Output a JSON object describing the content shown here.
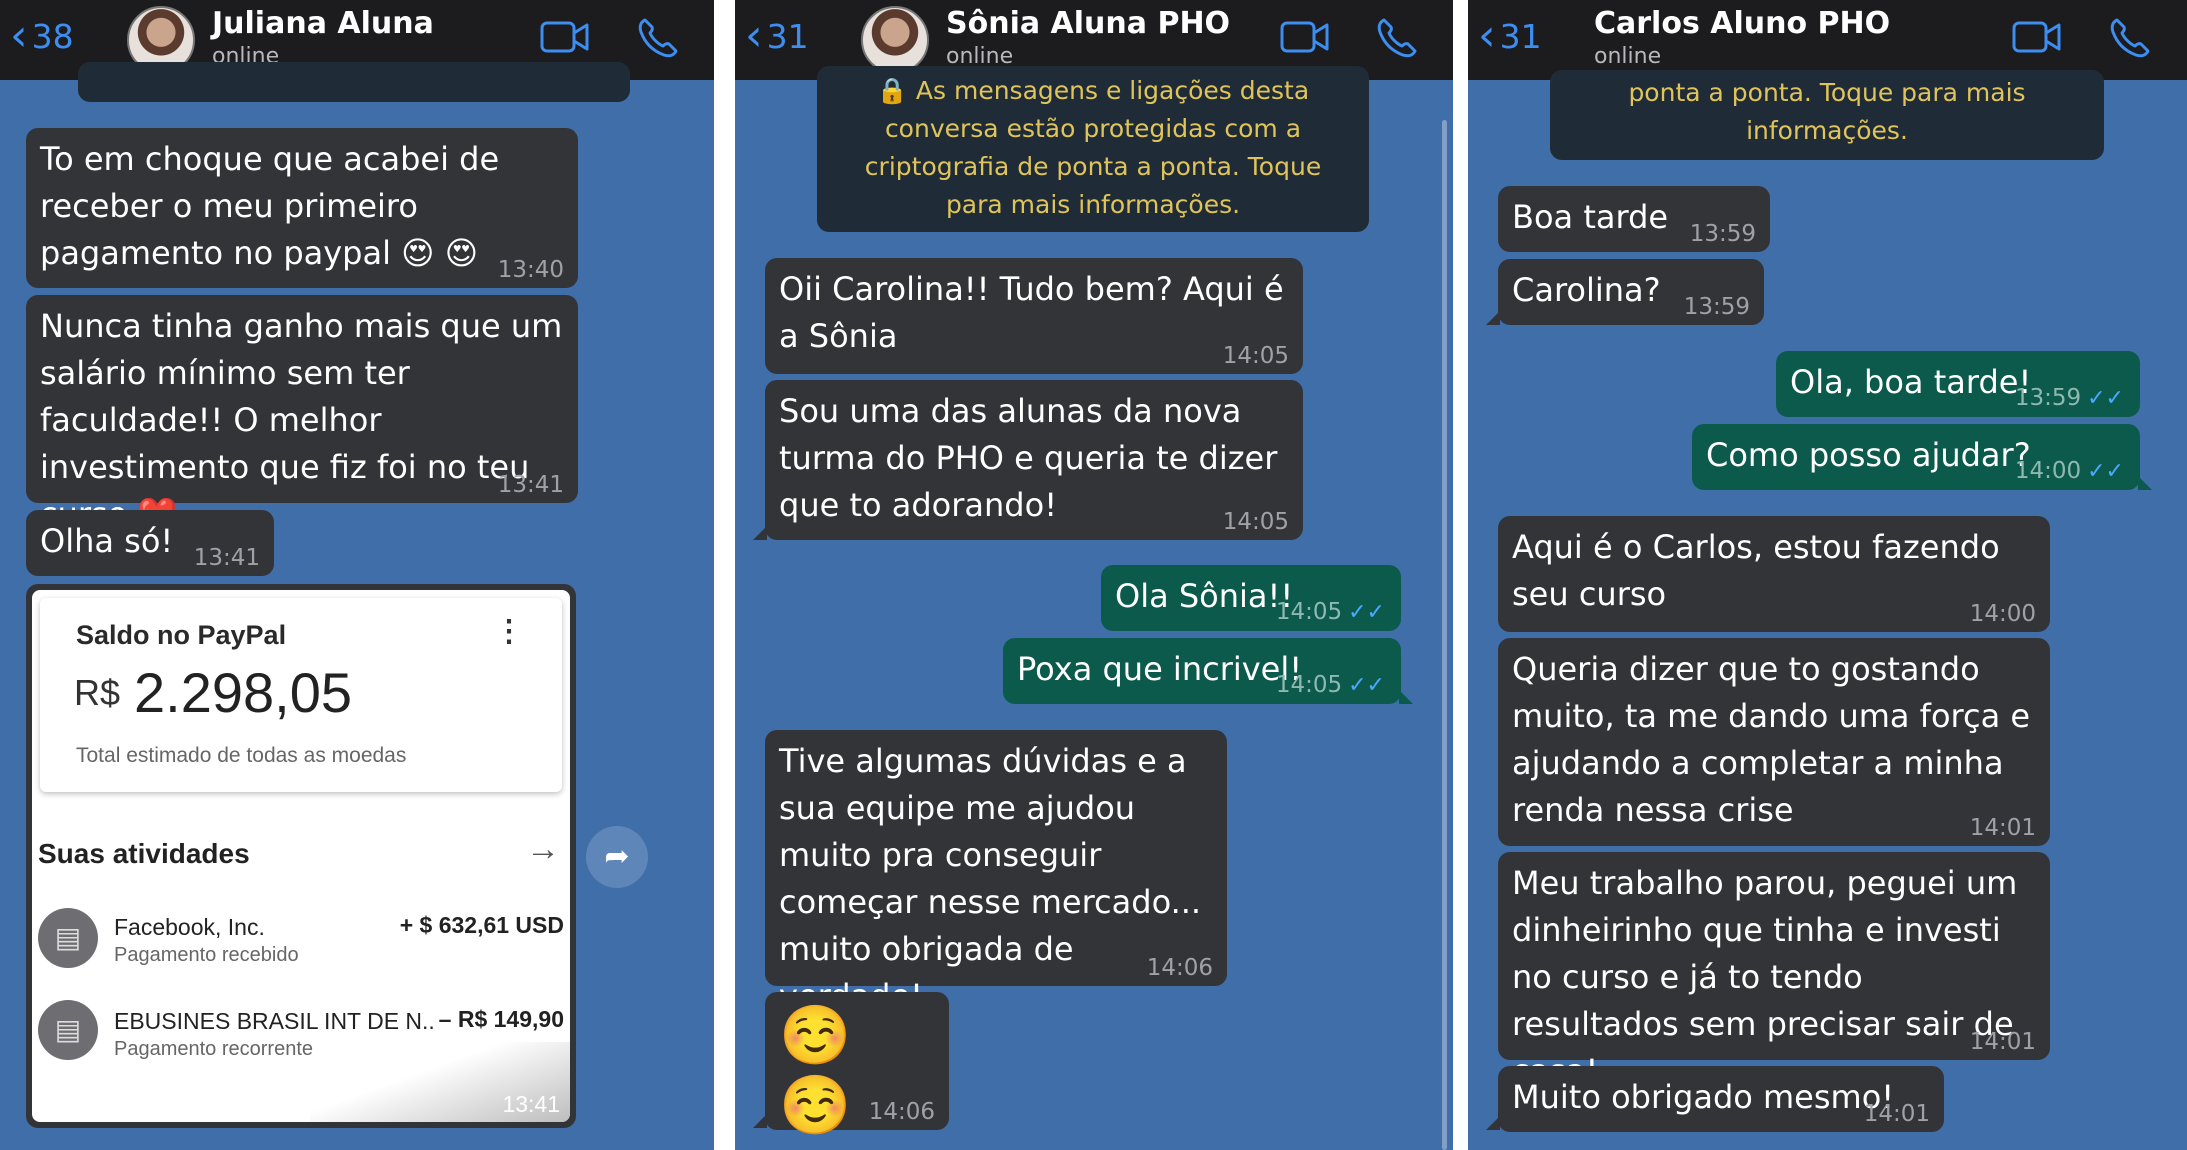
{
  "panels": [
    {
      "back_count": "38",
      "contact_name": "Juliana Aluna",
      "status": "online",
      "messages": [
        {
          "text": "To em choque que acabei de receber o meu primeiro pagamento no paypal 😍 😍",
          "time": "13:40"
        },
        {
          "text": "Nunca tinha ganho mais que um salário mínimo sem ter faculdade!! O melhor investimento que fiz foi no teu curso ❤️",
          "time": "13:41"
        },
        {
          "text": "Olha só!",
          "time": "13:41"
        }
      ],
      "paypal": {
        "label": "Saldo no PayPal",
        "currency": "R$",
        "amount": "2.298,05",
        "subtitle": "Total estimado de todas as moedas",
        "activities_title": "Suas atividades",
        "activities": [
          {
            "name": "Facebook, Inc.",
            "desc": "Pagamento recebido",
            "value": "+ $ 632,61 USD"
          },
          {
            "name": "EBUSINES BRASIL INT DE N...",
            "desc": "Pagamento recorrente",
            "value": "– R$ 149,90"
          }
        ],
        "time": "13:41"
      }
    },
    {
      "back_count": "31",
      "contact_name": "Sônia Aluna PHO",
      "status": "online",
      "system_message": "🔒 As mensagens e ligações desta conversa estão protegidas com a criptografia de ponta a ponta. Toque para mais informações.",
      "messages": [
        {
          "text": "Oii Carolina!! Tudo bem? Aqui é a Sônia",
          "time": "14:05",
          "dir": "in"
        },
        {
          "text": "Sou uma das alunas da nova turma do PHO e queria te dizer que to adorando!",
          "time": "14:05",
          "dir": "in"
        },
        {
          "text": "Ola Sônia!!",
          "time": "14:05",
          "dir": "out"
        },
        {
          "text": "Poxa que incrivel!",
          "time": "14:05",
          "dir": "out"
        },
        {
          "text": "Tive algumas dúvidas e a sua equipe me ajudou muito pra conseguir começar nesse mercado... muito obrigada de verdade!",
          "time": "14:06",
          "dir": "in"
        },
        {
          "text": "☺️ ☺️",
          "time": "14:06",
          "dir": "in"
        }
      ]
    },
    {
      "back_count": "31",
      "contact_name": "Carlos Aluno PHO",
      "status": "online",
      "system_message": "ponta a ponta. Toque para mais informações.",
      "messages": [
        {
          "text": "Boa tarde",
          "time": "13:59",
          "dir": "in"
        },
        {
          "text": "Carolina?",
          "time": "13:59",
          "dir": "in"
        },
        {
          "text": "Ola, boa tarde!",
          "time": "13:59",
          "dir": "out"
        },
        {
          "text": "Como posso ajudar?",
          "time": "14:00",
          "dir": "out"
        },
        {
          "text": "Aqui é o Carlos, estou fazendo seu curso",
          "time": "14:00",
          "dir": "in"
        },
        {
          "text": "Queria dizer que to gostando muito, ta me dando uma força e ajudando a completar a minha renda nessa crise",
          "time": "14:01",
          "dir": "in"
        },
        {
          "text": "Meu trabalho parou, peguei um dinheirinho que tinha e investi no curso e já to tendo resultados sem precisar sair de casa!",
          "time": "14:01",
          "dir": "in"
        },
        {
          "text": "Muito obrigado mesmo!",
          "time": "14:01",
          "dir": "in"
        }
      ]
    }
  ],
  "icons": {
    "back": "chevron-left-icon",
    "video": "video-camera-icon",
    "call": "phone-icon",
    "read": "double-check-icon",
    "forward": "forward-arrow-icon",
    "store": "store-icon"
  },
  "colors": {
    "chat_background": "#3f6ea9",
    "incoming_bubble": "#333438",
    "outgoing_bubble": "#0b5a4c",
    "header": "#1c1c1e",
    "accent": "#3d8ef0",
    "read_ticks": "#4aa8ff"
  }
}
